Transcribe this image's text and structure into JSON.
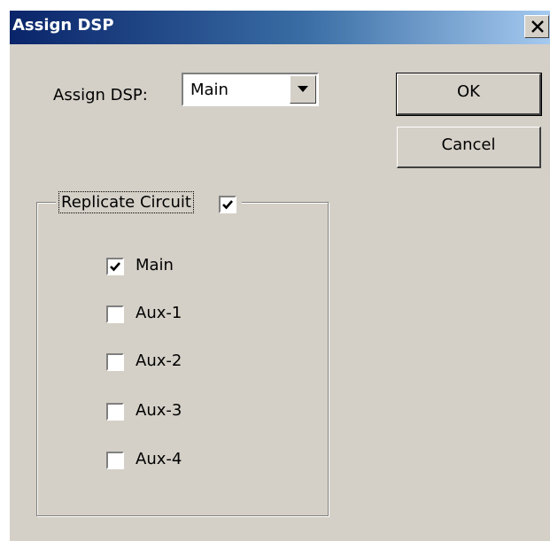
{
  "window": {
    "title": "Assign DSP"
  },
  "assign": {
    "label": "Assign DSP:",
    "selected": "Main"
  },
  "buttons": {
    "ok": "OK",
    "cancel": "Cancel"
  },
  "replicate": {
    "label": "Replicate Circuit",
    "checked": true,
    "options": [
      {
        "label": "Main",
        "checked": true
      },
      {
        "label": "Aux-1",
        "checked": false
      },
      {
        "label": "Aux-2",
        "checked": false
      },
      {
        "label": "Aux-3",
        "checked": false
      },
      {
        "label": "Aux-4",
        "checked": false
      }
    ]
  }
}
